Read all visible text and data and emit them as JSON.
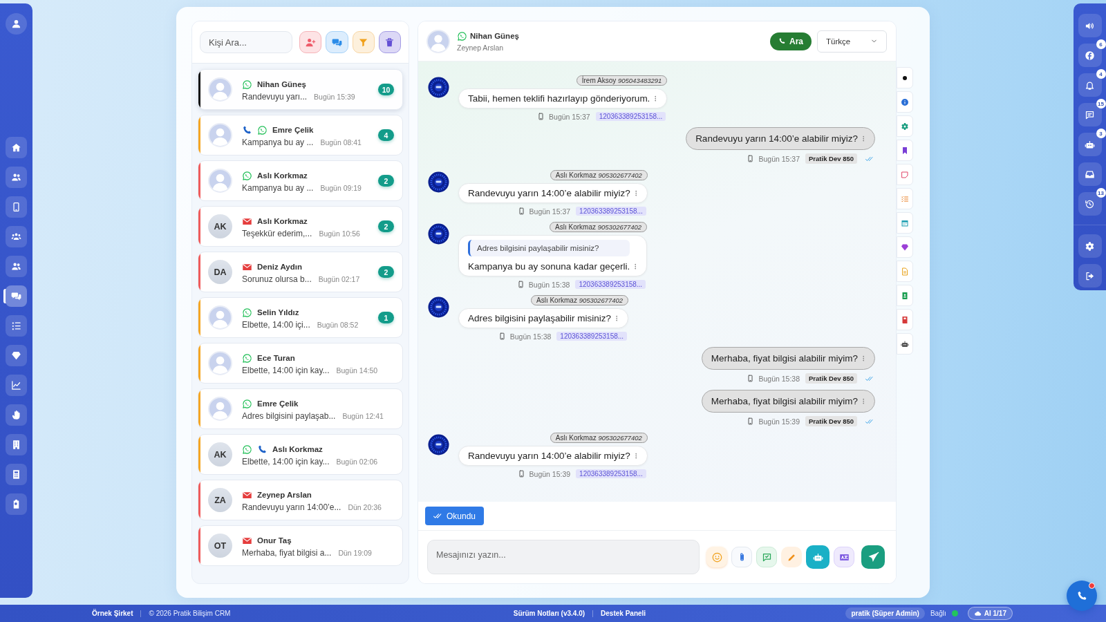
{
  "nav": {
    "items": [
      {
        "kind": "profile",
        "selected": false
      },
      {
        "kind": "home",
        "selected": false
      },
      {
        "kind": "users",
        "selected": false
      },
      {
        "kind": "mobile",
        "selected": false
      },
      {
        "kind": "usergroup",
        "selected": false
      },
      {
        "kind": "users",
        "selected": false
      },
      {
        "kind": "comments",
        "selected": true
      },
      {
        "kind": "list",
        "selected": false
      },
      {
        "kind": "gem",
        "selected": false
      },
      {
        "kind": "chart",
        "selected": false
      },
      {
        "kind": "hand",
        "selected": false
      },
      {
        "kind": "building",
        "selected": false
      },
      {
        "kind": "calculator",
        "selected": false
      },
      {
        "kind": "clipboard",
        "selected": false
      }
    ]
  },
  "contacts": {
    "search": {
      "placeholder": "Kişi Ara..."
    },
    "items": [
      {
        "name": "Nihan Güneş",
        "preview": "Randevuyu yarı...",
        "time": "Bugün 15:39",
        "unread": "10",
        "channels": [
          {
            "kind": "whatsapp"
          }
        ],
        "color": "#111111",
        "selected": true
      },
      {
        "name": "Emre Çelik",
        "preview": "Kampanya bu ay ...",
        "time": "Bugün 08:41",
        "unread": "4",
        "channels": [
          {
            "kind": "phone"
          },
          {
            "kind": "whatsapp"
          }
        ],
        "color": "#f5a623",
        "selected": false
      },
      {
        "name": "Aslı Korkmaz",
        "preview": "Kampanya bu ay ...",
        "time": "Bugün 09:19",
        "unread": "2",
        "channels": [
          {
            "kind": "whatsapp"
          }
        ],
        "color": "#ef5b5b",
        "selected": false
      },
      {
        "name": "Aslı Korkmaz",
        "initials": "AK",
        "preview": "Teşekkür ederim,...",
        "time": "Bugün 10:56",
        "unread": "2",
        "channels": [
          {
            "kind": "email"
          }
        ],
        "color": "#ef5b5b",
        "selected": false
      },
      {
        "name": "Deniz Aydın",
        "initials": "DA",
        "preview": "Sorunuz olursa b...",
        "time": "Bugün 02:17",
        "unread": "2",
        "channels": [
          {
            "kind": "email"
          }
        ],
        "color": "#ef5b5b",
        "selected": false
      },
      {
        "name": "Selin Yıldız",
        "preview": "Elbette, 14:00 içi...",
        "time": "Bugün 08:52",
        "unread": "1",
        "channels": [
          {
            "kind": "whatsapp"
          }
        ],
        "color": "#f5a623",
        "selected": false
      },
      {
        "name": "Ece Turan",
        "preview": "Elbette, 14:00 için kay...",
        "time": "Bugün 14:50",
        "channels": [
          {
            "kind": "whatsapp"
          }
        ],
        "color": "#f5a623",
        "selected": false
      },
      {
        "name": "Emre Çelik",
        "preview": "Adres bilgisini paylaşab...",
        "time": "Bugün 12:41",
        "channels": [
          {
            "kind": "whatsapp"
          }
        ],
        "color": "#f5a623",
        "selected": false
      },
      {
        "name": "Aslı Korkmaz",
        "initials": "AK",
        "preview": "Elbette, 14:00 için kay...",
        "time": "Bugün 02:06",
        "channels": [
          {
            "kind": "whatsapp"
          },
          {
            "kind": "phone"
          }
        ],
        "color": "#f5a623",
        "selected": false
      },
      {
        "name": "Zeynep Arslan",
        "initials": "ZA",
        "preview": "Randevuyu yarın 14:00’e...",
        "time": "Dün 20:36",
        "channels": [
          {
            "kind": "email"
          }
        ],
        "color": "#ef5b5b",
        "selected": false
      },
      {
        "name": "Onur Taş",
        "initials": "OT",
        "preview": "Merhaba, fiyat bilgisi a...",
        "time": "Dün 19:09",
        "channels": [
          {
            "kind": "email"
          }
        ],
        "color": "#ef5b5b",
        "selected": false
      }
    ]
  },
  "chat": {
    "name": "Nihan Güneş",
    "channel": {
      "kind": "whatsapp"
    },
    "subtitle": "Zeynep Arslan",
    "call_button": "Ara",
    "language": "Türkçe",
    "messages": [
      {
        "kind": "incoming",
        "sender": "İrem Aksoy",
        "phone": "905043483291",
        "text": "Tabii, hemen teklifi hazırlayıp gönderiyorum.",
        "time": "Bugün 15:37",
        "ref": "120363389253158..."
      },
      {
        "kind": "outgoing",
        "text": "Randevuyu yarın 14:00’e alabilir miyiz?",
        "time": "Bugün 15:37",
        "agent": "Pratik Dev 850",
        "read": true
      },
      {
        "kind": "incoming",
        "sender": "Aslı Korkmaz",
        "phone": "905302677402",
        "text": "Randevuyu yarın 14:00’e alabilir miyiz?",
        "time": "Bugün 15:37",
        "ref": "120363389253158..."
      },
      {
        "kind": "incoming",
        "sender": "Aslı Korkmaz",
        "phone": "905302677402",
        "quote": "Adres bilgisini paylaşabilir misiniz?",
        "text": "Kampanya bu ay sonuna kadar geçerli.",
        "time": "Bugün 15:38",
        "ref": "120363389253158..."
      },
      {
        "kind": "incoming",
        "sender": "Aslı Korkmaz",
        "phone": "905302677402",
        "text": "Adres bilgisini paylaşabilir misiniz?",
        "time": "Bugün 15:38",
        "ref": "120363389253158..."
      },
      {
        "kind": "outgoing",
        "text": "Merhaba, fiyat bilgisi alabilir miyim?",
        "time": "Bugün 15:38",
        "agent": "Pratik Dev 850",
        "read": true
      },
      {
        "kind": "outgoing",
        "text": "Merhaba, fiyat bilgisi alabilir miyim?",
        "time": "Bugün 15:39",
        "agent": "Pratik Dev 850",
        "read": true
      },
      {
        "kind": "incoming",
        "sender": "Aslı Korkmaz",
        "phone": "905302677402",
        "text": "Randevuyu yarın 14:00’e alabilir miyiz?",
        "time": "Bugün 15:39",
        "ref": "120363389253158..."
      }
    ],
    "mark_read_button": "Okundu",
    "composer": {
      "placeholder": "Mesajınızı yazın..."
    }
  },
  "right_bar": {
    "items": [
      {
        "kind": "speaker"
      },
      {
        "kind": "facebook",
        "badge": "6"
      },
      {
        "kind": "bell",
        "badge": "4"
      },
      {
        "kind": "comment",
        "badge": "15"
      },
      {
        "kind": "robot",
        "badge": "3"
      },
      {
        "kind": "inbox"
      },
      {
        "kind": "history",
        "badge": "13"
      },
      {
        "kind": "gear"
      },
      {
        "kind": "logout"
      }
    ]
  },
  "footer": {
    "company": "Örnek Şirket",
    "copyright": "© 2026 Pratik Bilişim CRM",
    "release_notes": "Sürüm Notları (v3.4.0)",
    "support": "Destek Paneli",
    "user": "pratik (Süper Admin)",
    "status": {
      "label": "Bağlı",
      "connected": true
    },
    "ai": "AI 1/17"
  }
}
